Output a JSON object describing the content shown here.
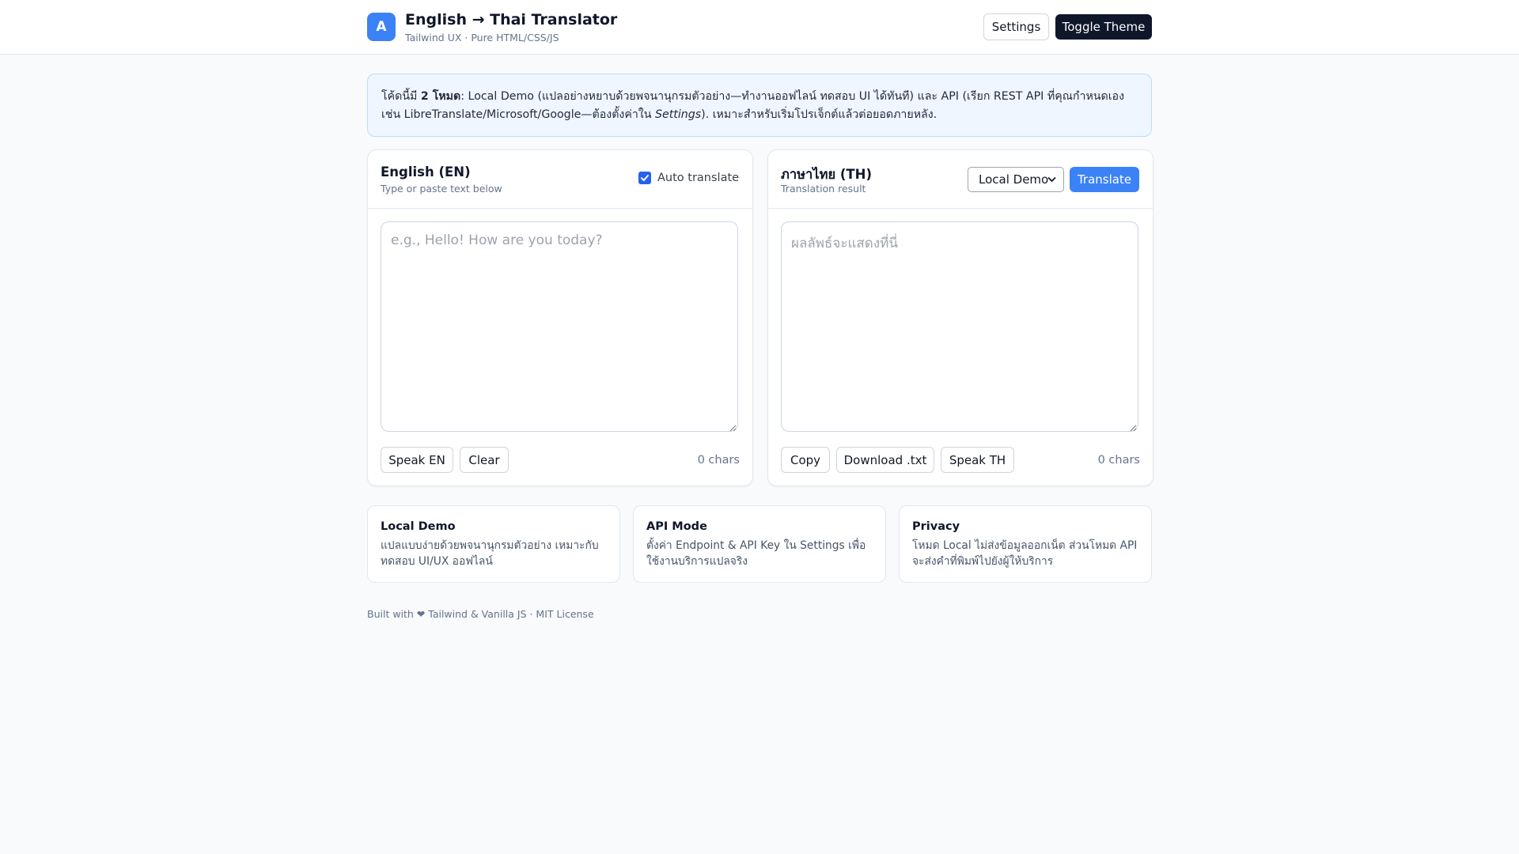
{
  "header": {
    "logo_letter": "A",
    "title": "English → Thai Translator",
    "subtitle": "Tailwind UX · Pure HTML/CSS/JS",
    "settings_label": "Settings",
    "toggle_theme_label": "Toggle Theme"
  },
  "banner": {
    "prefix": "โค้ดนี้มี ",
    "bold": "2 โหมด",
    "middle": ": Local Demo (แปลอย่างหยาบด้วยพจนานุกรมตัวอย่าง—ทำงานออฟไลน์ ทดสอบ UI ได้ทันที) และ API (เรียก REST API ที่คุณกำหนดเอง เช่น LibreTranslate/Microsoft/Google—ต้องตั้งค่าใน ",
    "italic": "Settings",
    "suffix": "). เหมาะสำหรับเริ่มโปรเจ็กต์แล้วต่อยอดภายหลัง."
  },
  "source": {
    "title": "English (EN)",
    "subtitle": "Type or paste text below",
    "auto_translate_label": "Auto translate",
    "auto_translate_checked": true,
    "input_value": "",
    "placeholder": "e.g., Hello! How are you today?",
    "speak_label": "Speak EN",
    "clear_label": "Clear",
    "chars": "0 chars"
  },
  "target": {
    "title": "ภาษาไทย (TH)",
    "subtitle": "Translation result",
    "mode_selected": "Local Demo",
    "translate_label": "Translate",
    "output_value": "",
    "placeholder": "ผลลัพธ์จะแสดงที่นี่",
    "copy_label": "Copy",
    "download_label": "Download .txt",
    "speak_label": "Speak TH",
    "chars": "0 chars"
  },
  "info_cards": [
    {
      "title": "Local Demo",
      "text": "แปลแบบง่ายด้วยพจนานุกรมตัวอย่าง เหมาะกับทดสอบ UI/UX ออฟไลน์"
    },
    {
      "title": "API Mode",
      "text": "ตั้งค่า Endpoint & API Key ใน Settings เพื่อใช้งานบริการแปลจริง"
    },
    {
      "title": "Privacy",
      "text": "โหมด Local ไม่ส่งข้อมูลออกเน็ต ส่วนโหมด API จะส่งคำที่พิมพ์ไปยังผู้ให้บริการ"
    }
  ],
  "footer": {
    "text": "Built with ❤ Tailwind & Vanilla JS · MIT License"
  },
  "colors": {
    "accent_blue": "#3b82f6",
    "dark": "#0f172a",
    "banner_bg": "#eff6ff",
    "page_bg": "#f8fafc"
  }
}
